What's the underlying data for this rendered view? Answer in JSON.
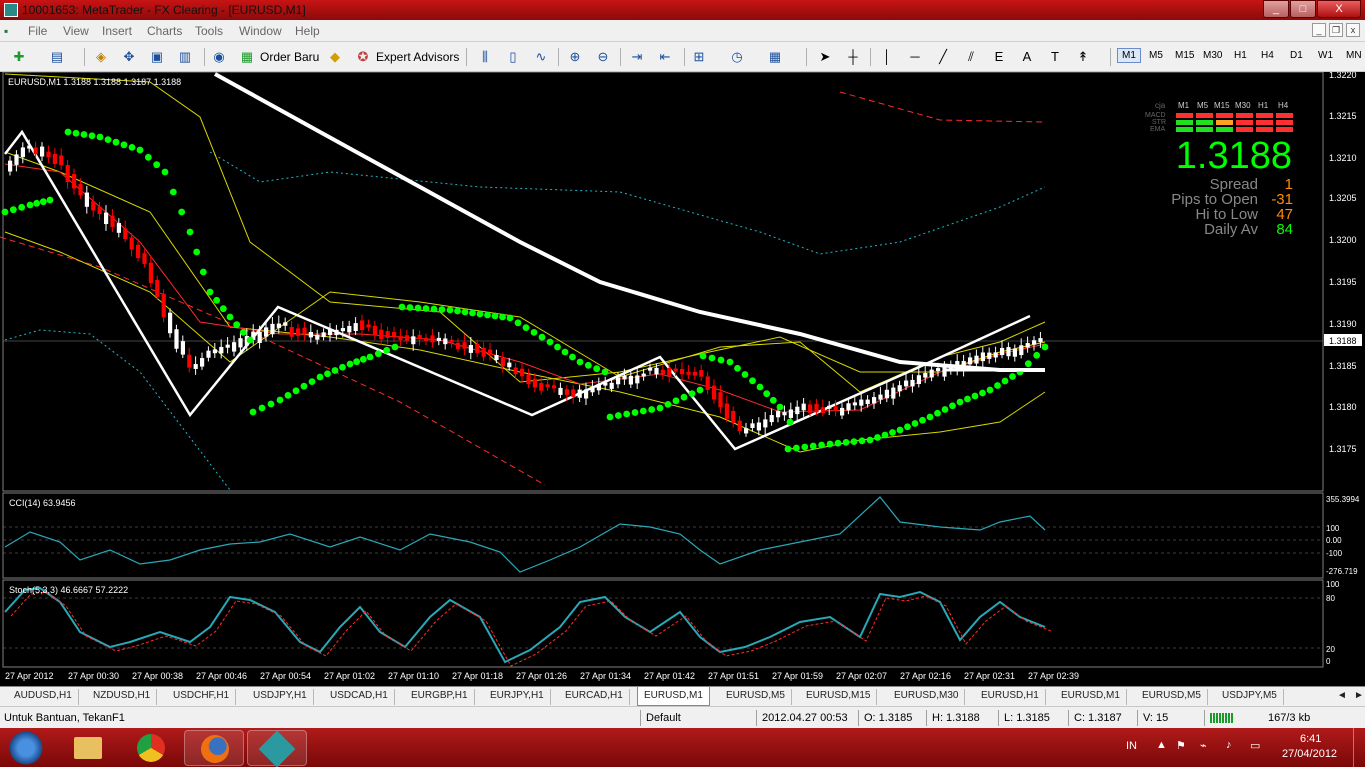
{
  "window": {
    "title": "10001653: MetaTrader - FX Clearing - [EURUSD,M1]",
    "controls": [
      "_",
      "□",
      "X"
    ]
  },
  "menu": [
    "File",
    "View",
    "Insert",
    "Charts",
    "Tools",
    "Window",
    "Help"
  ],
  "mdi_controls": [
    "_",
    "❐",
    "x"
  ],
  "toolbar": {
    "new_order": "Order Baru",
    "expert_advisors": "Expert Advisors",
    "timeframes": [
      "M1",
      "M5",
      "M15",
      "M30",
      "H1",
      "H4",
      "D1",
      "W1",
      "MN"
    ],
    "active_timeframe": "M1"
  },
  "chart": {
    "header": "EURUSD,M1  1.3188 1.3188 1.3187 1.3188",
    "price_axis": [
      "1.3220",
      "1.3215",
      "1.3210",
      "1.3205",
      "1.3200",
      "1.3195",
      "1.3190",
      "1.3185",
      "1.3180",
      "1.3175"
    ],
    "current_price": "1.3188",
    "time_axis": [
      "27 Apr 2012",
      "27 Apr 00:30",
      "27 Apr 00:38",
      "27 Apr 00:46",
      "27 Apr 00:54",
      "27 Apr 01:02",
      "27 Apr 01:10",
      "27 Apr 01:18",
      "27 Apr 01:26",
      "27 Apr 01:34",
      "27 Apr 01:42",
      "27 Apr 01:51",
      "27 Apr 01:59",
      "27 Apr 02:07",
      "27 Apr 02:16",
      "27 Apr 02:31",
      "27 Apr 02:39"
    ],
    "colors": {
      "bull": "#ffffff",
      "bear": "#ff0000",
      "psar": "#00ff00",
      "bands": "#d8d800",
      "envelope": "#20b8c8",
      "zigzag": "#ffffff"
    }
  },
  "dashboard": {
    "columns": [
      "cja",
      "M1",
      "M5",
      "M15",
      "M30",
      "H1",
      "H4"
    ],
    "rows": [
      "MACD",
      "STR",
      "EMA"
    ],
    "big_price": "1.3188",
    "stats": [
      {
        "label": "Spread",
        "value": "1",
        "color": "#ff8c00"
      },
      {
        "label": "Pips to Open",
        "value": "-31",
        "color": "#ff8c00"
      },
      {
        "label": "Hi to Low",
        "value": "47",
        "color": "#ff8c00"
      },
      {
        "label": "Daily Av",
        "value": "84",
        "color": "#00ff00"
      }
    ]
  },
  "cci": {
    "label": "CCI(14) 63.9456",
    "axis": [
      "355.3994",
      "100",
      "0.00",
      "-100",
      "-276.719"
    ]
  },
  "stoch": {
    "label": "Stoch(5,3,3) 46.6667 57.2222",
    "axis": [
      "100",
      "80",
      "20",
      "0"
    ]
  },
  "tabs": [
    "AUDUSD,H1",
    "NZDUSD,H1",
    "USDCHF,H1",
    "USDJPY,H1",
    "USDCAD,H1",
    "EURGBP,H1",
    "EURJPY,H1",
    "EURCAD,H1",
    "EURUSD,M1",
    "EURUSD,M5",
    "EURUSD,M15",
    "EURUSD,M30",
    "EURUSD,H1",
    "EURUSD,M1",
    "EURUSD,M5",
    "USDJPY,M5"
  ],
  "active_tab": "EURUSD,M1",
  "status": {
    "help": "Untuk Bantuan, TekanF1",
    "profile": "Default",
    "datetime": "2012.04.27 00:53",
    "open": "O: 1.3185",
    "high": "H: 1.3188",
    "low": "L: 1.3185",
    "close": "C: 1.3187",
    "volume": "V: 15",
    "traffic": "167/3 kb"
  },
  "taskbar": {
    "lang": "IN",
    "time": "6:41",
    "date": "27/04/2012"
  }
}
